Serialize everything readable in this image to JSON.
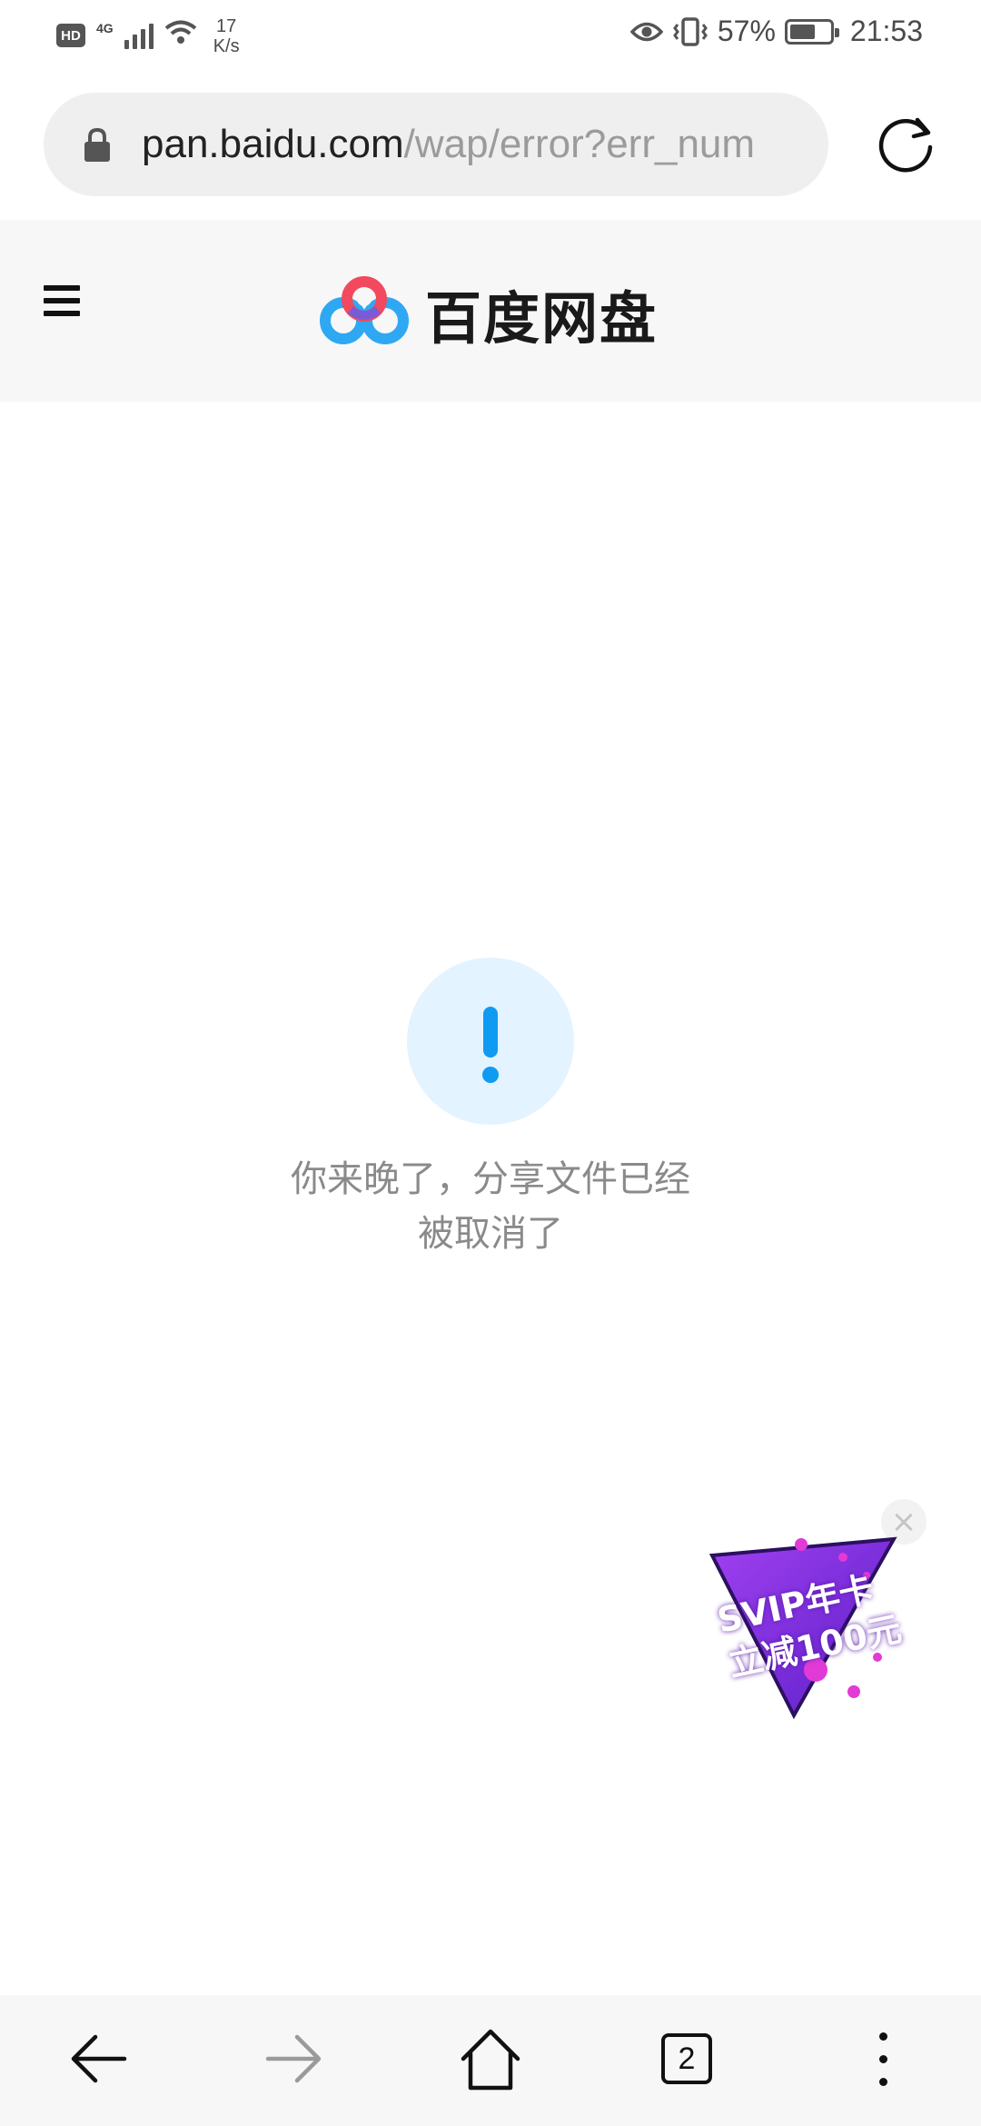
{
  "status_bar": {
    "hd_label": "HD",
    "network_type": "4G",
    "speed_value": "17",
    "speed_unit": "K/s",
    "battery_percent": "57%",
    "battery_level": 0.57,
    "time": "21:53"
  },
  "browser": {
    "url_host": "pan.baidu.com",
    "url_path": "/wap/error?err_num",
    "open_tabs": "2"
  },
  "site": {
    "brand_name": "百度网盘"
  },
  "error": {
    "message_line1": "你来晚了，分享文件已经",
    "message_line2": "被取消了"
  },
  "promo": {
    "line1": "SVIP年卡",
    "line2": "立减100元",
    "close_symbol": "×"
  },
  "colors": {
    "accent_blue": "#0f9bf2",
    "promo_purple": "#7a2ee0",
    "promo_pink": "#e23ad6"
  },
  "icons": {
    "lock": "lock-icon",
    "reload": "reload-icon",
    "menu": "menu-icon",
    "back": "back-arrow-icon",
    "forward": "forward-arrow-icon",
    "home": "home-icon",
    "more": "more-vertical-icon"
  }
}
